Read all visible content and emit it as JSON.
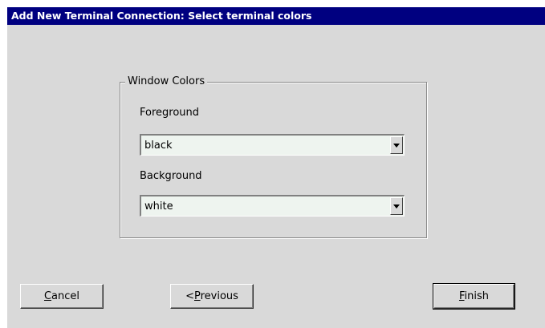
{
  "dialog": {
    "title": "Add New Terminal Connection: Select terminal colors"
  },
  "window_colors": {
    "legend": "Window Colors",
    "foreground": {
      "label": "Foreground",
      "selected": "black"
    },
    "background": {
      "label": "Background",
      "selected": "white"
    }
  },
  "buttons": {
    "cancel": {
      "mnemonic": "C",
      "rest": "ancel"
    },
    "previous": {
      "prefix": "<",
      "mnemonic": "P",
      "rest": "revious"
    },
    "finish": {
      "mnemonic": "F",
      "rest": "inish"
    }
  },
  "colors": {
    "titlebar": "#000080",
    "dialog_bg": "#d9d9d9",
    "field_bg": "#eef4ef"
  }
}
